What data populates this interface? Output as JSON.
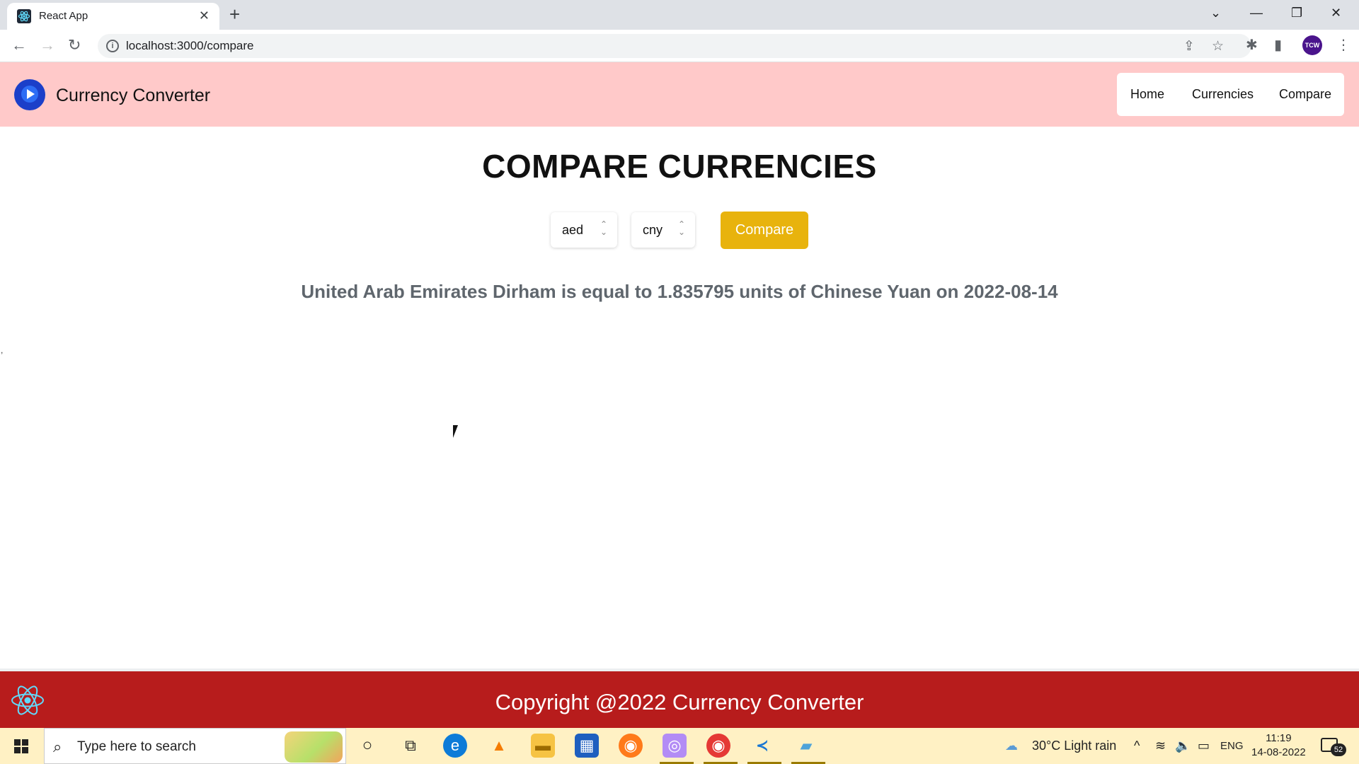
{
  "browser": {
    "tab_title": "React App",
    "tab_close": "✕",
    "new_tab": "+",
    "url": "localhost:3000/compare",
    "profile_initials": "TCW",
    "window_controls": {
      "dropdown": "⌄",
      "minimize": "—",
      "restore": "❐",
      "close": "✕"
    },
    "nav": {
      "back": "←",
      "forward": "→",
      "reload": "↻"
    }
  },
  "header": {
    "brand": "Currency Converter",
    "nav_items": [
      "Home",
      "Currencies",
      "Compare"
    ]
  },
  "main": {
    "title": "COMPARE CURRENCIES",
    "from_currency": "aed",
    "to_currency": "cny",
    "compare_button": "Compare",
    "result": "United Arab Emirates Dirham is equal to 1.835795 units of Chinese Yuan on 2022-08-14"
  },
  "footer": {
    "copyright": "Copyright @2022 Currency Converter"
  },
  "taskbar": {
    "search_placeholder": "Type here to search",
    "weather": "30°C  Light rain",
    "language": "ENG",
    "time": "11:19",
    "date": "14-08-2022",
    "notification_count": "52"
  },
  "colors": {
    "header_bg": "#ffc9c9",
    "compare_button": "#e8b30d",
    "footer_bg": "#b71c1c",
    "result_text": "#5f666d"
  }
}
